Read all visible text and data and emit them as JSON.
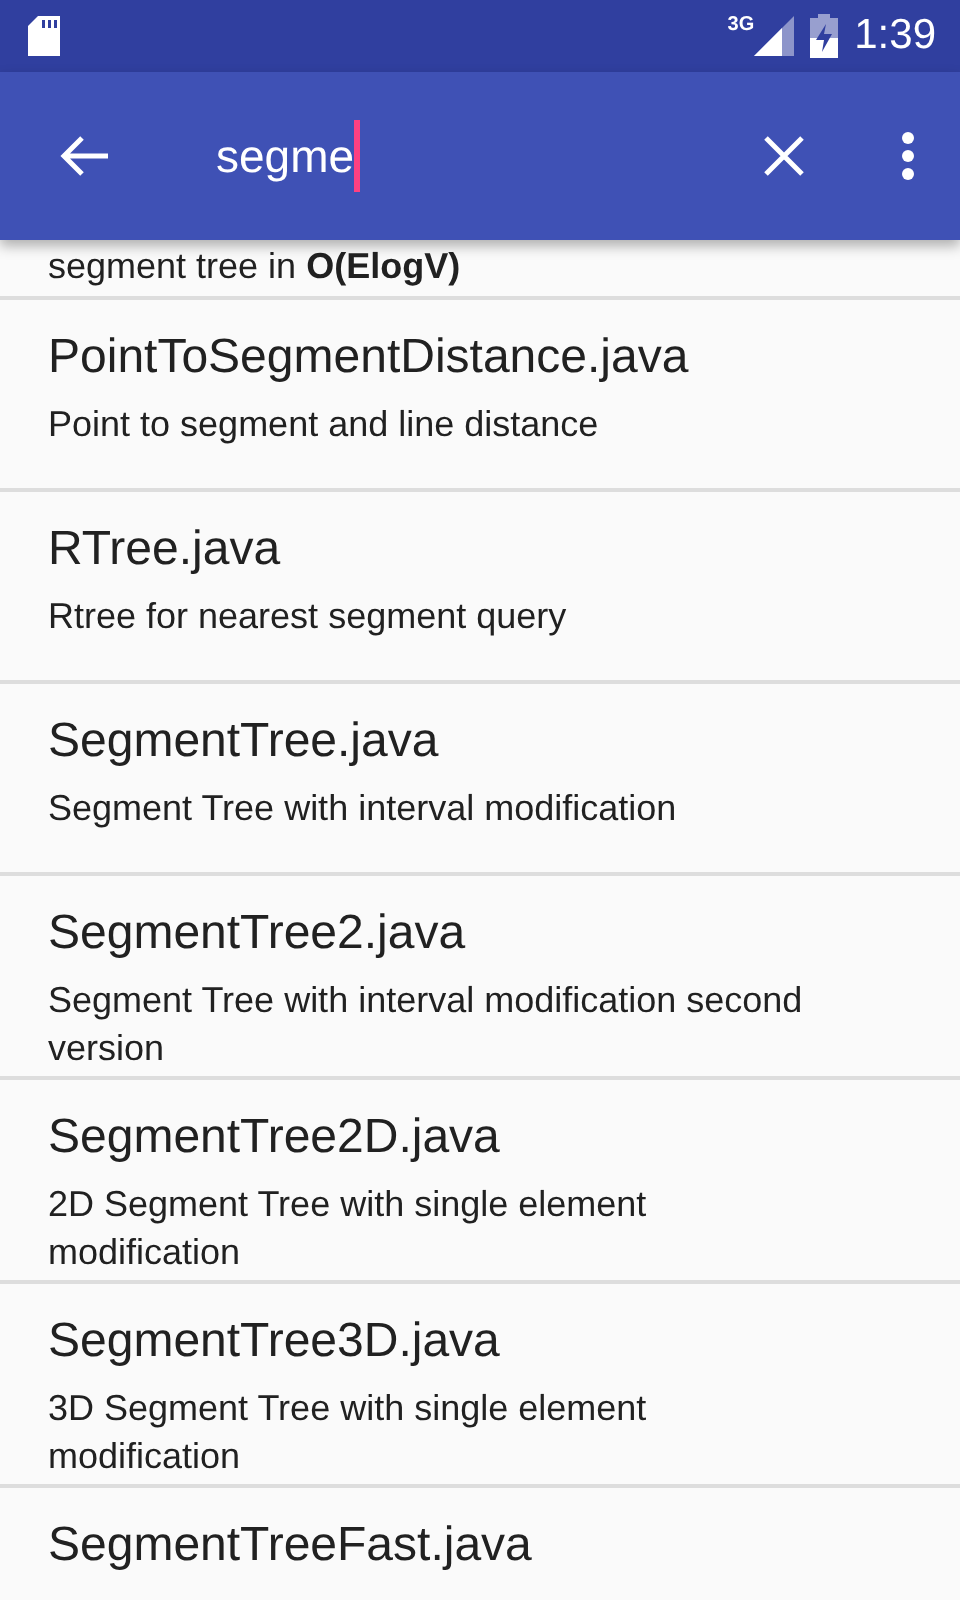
{
  "status_bar": {
    "network": "3G",
    "time": "1:39"
  },
  "search": {
    "value": "segme"
  },
  "results": [
    {
      "kind": "partial",
      "description": "segment tree in **O(ElogV)**"
    },
    {
      "kind": "full",
      "title": "PointToSegmentDistance.java",
      "description": "Point to segment and line distance"
    },
    {
      "kind": "full",
      "title": "RTree.java",
      "description": "Rtree for nearest segment query"
    },
    {
      "kind": "full",
      "title": "SegmentTree.java",
      "description": "Segment Tree with interval modification"
    },
    {
      "kind": "full",
      "title": "SegmentTree2.java",
      "description": "Segment Tree with interval modification second version"
    },
    {
      "kind": "full",
      "title": "SegmentTree2D.java",
      "description": "2D Segment Tree with single element modification"
    },
    {
      "kind": "full",
      "title": "SegmentTree3D.java",
      "description": "3D Segment Tree with single element modification"
    },
    {
      "kind": "full",
      "title": "SegmentTreeFast.java"
    }
  ]
}
